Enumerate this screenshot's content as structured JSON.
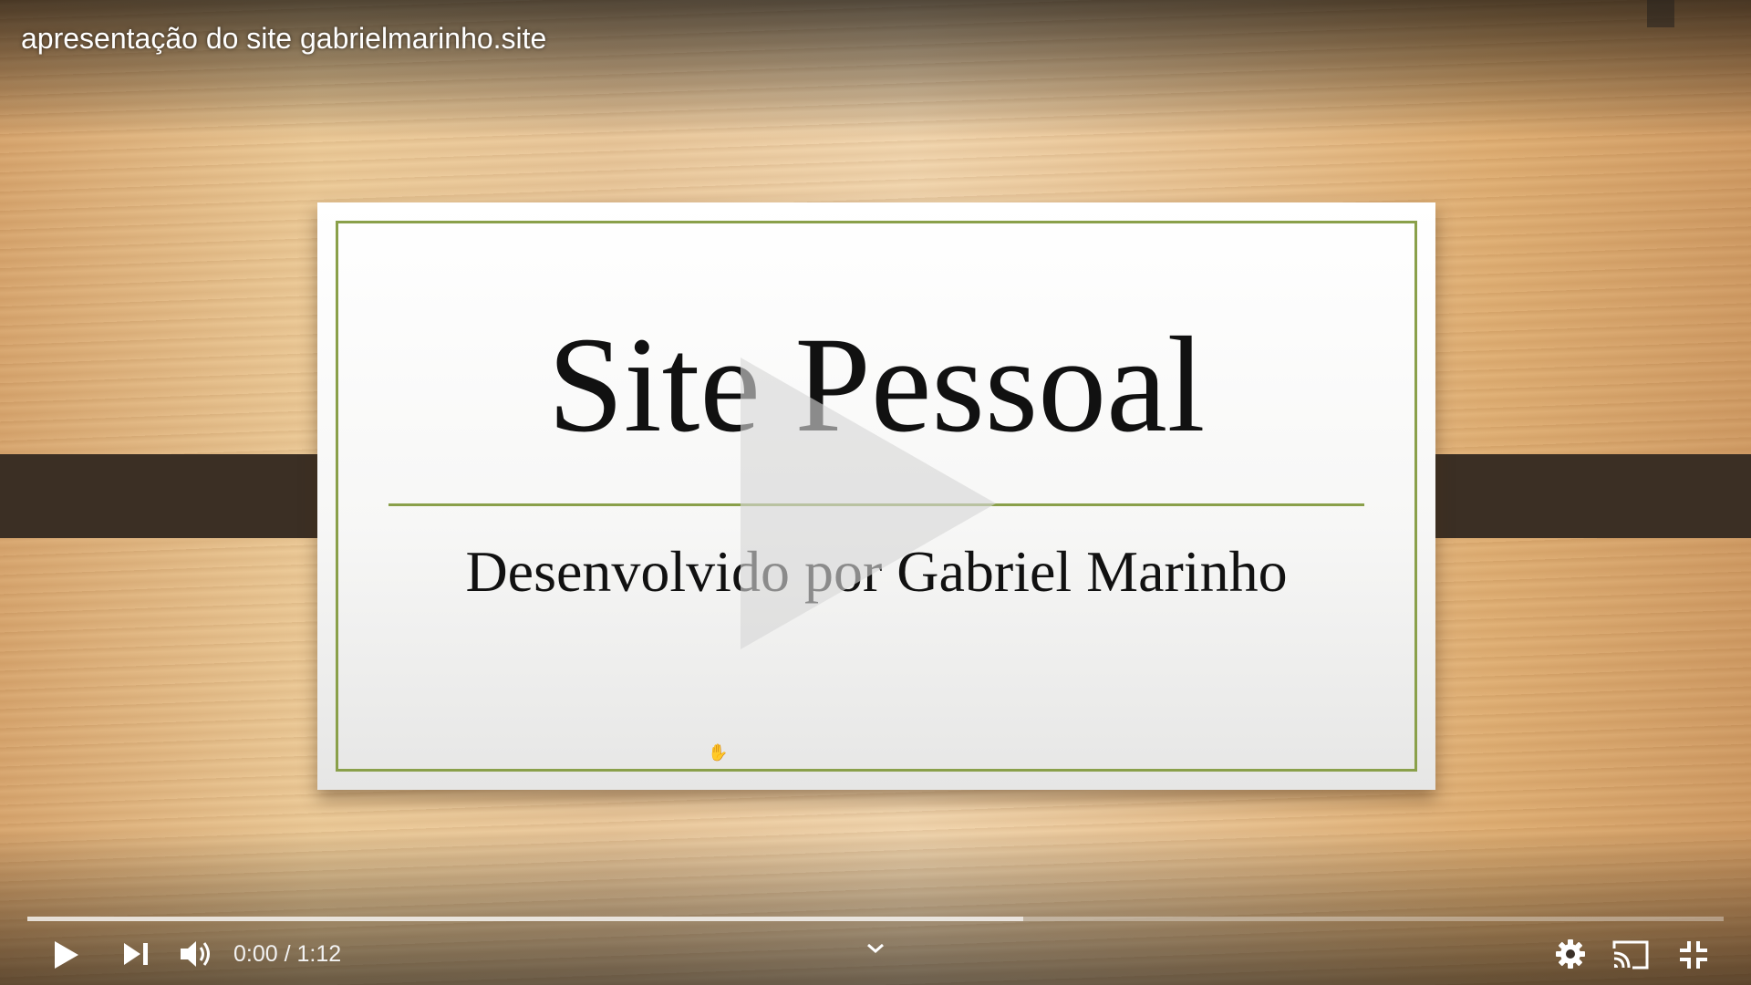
{
  "video": {
    "title": "apresentação do site gabrielmarinho.site"
  },
  "slide": {
    "title": "Site Pessoal",
    "subtitle": "Desenvolvido por Gabriel Marinho"
  },
  "controls": {
    "current_time": "0:00",
    "separator": "/",
    "duration": "1:12",
    "loaded_fraction": 0.587,
    "icons": [
      "play-icon",
      "next-icon",
      "volume-icon",
      "chevron-down-icon",
      "settings-gear-icon",
      "cast-icon",
      "exit-fullscreen-icon"
    ]
  },
  "colors": {
    "slide_accent": "#8aa04a",
    "band": "#3b2f24",
    "controls_text": "#f2f2f2"
  }
}
